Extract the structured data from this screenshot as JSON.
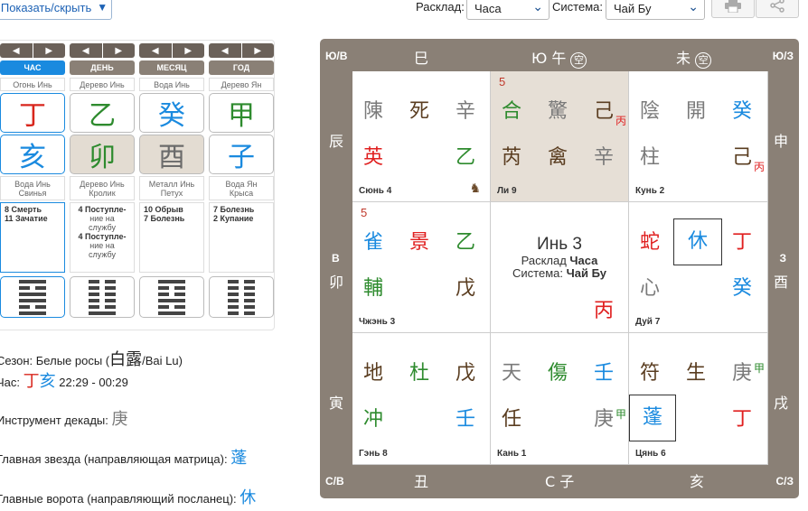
{
  "toolbar": {
    "toggle_label": "Показать/скрыть",
    "layout_label": "Расклад:",
    "layout_value": "Часа",
    "system_label": "Система:",
    "system_value": "Чай Бу"
  },
  "calendar": {
    "columns": [
      {
        "head": "ЧАС",
        "element": "Огонь Инь",
        "stem": "丁",
        "branch": "亥",
        "animal1": "Вода Инь",
        "animal2": "Свинья",
        "spirits": [
          "8 Смерть",
          "11 Зачатие"
        ]
      },
      {
        "head": "ДЕНЬ",
        "element": "Дерево Инь",
        "stem": "乙",
        "branch": "卯",
        "animal1": "Дерево Инь",
        "animal2": "Кролик",
        "spirits": [
          "4 Поступле-",
          "ние на",
          "службу",
          "4 Поступле-",
          "ние на",
          "службу"
        ]
      },
      {
        "head": "МЕСЯЦ",
        "element": "Вода Инь",
        "stem": "癸",
        "branch": "酉",
        "animal1": "Металл Инь",
        "animal2": "Петух",
        "spirits": [
          "10 Обрыв",
          "7 Болезнь"
        ]
      },
      {
        "head": "ГОД",
        "element": "Дерево Ян",
        "stem": "甲",
        "branch": "子",
        "animal1": "Вода Ян",
        "animal2": "Крыса",
        "spirits": [
          "7 Болезнь",
          "2 Купание"
        ]
      }
    ]
  },
  "info": {
    "season_label": "Сезон: Белые росы (",
    "season_ch": "白露",
    "season_tail": "/Bai Lu)",
    "hour_label": "Час:",
    "hour_ch1": "丁",
    "hour_ch2": "亥",
    "hour_time": "22:29 - 00:29",
    "decade_label": "Инструмент декады:",
    "decade_ch": "庚",
    "star_label": "Главная звезда (направляющая матрица):",
    "star_ch": "蓬",
    "gate_label": "Главные ворота (направляющий посланец):",
    "gate_ch": "休"
  },
  "board": {
    "corners": {
      "tl": "Ю/В",
      "tr": "Ю/З",
      "bl": "С/В",
      "br": "С/З"
    },
    "top": [
      "巳",
      "Ю 午",
      "未"
    ],
    "bottom": [
      "丑",
      "С 子",
      "亥"
    ],
    "left": [
      "辰",
      "В",
      "卯",
      "寅"
    ],
    "right": [
      "申",
      "З",
      "酉",
      "戌"
    ],
    "void_mark": "空",
    "cells": {
      "xun": {
        "name": "Сюнь 4",
        "r1": [
          "陳",
          "死",
          "辛"
        ],
        "r2": [
          "英",
          "",
          "乙"
        ]
      },
      "li": {
        "name": "Ли 9",
        "num": "5",
        "r1": [
          "合",
          "驚",
          "己"
        ],
        "r1sub": "丙",
        "r2": [
          "芮",
          "禽",
          "辛"
        ]
      },
      "kun": {
        "name": "Кунь 2",
        "r1": [
          "陰",
          "開",
          "癸"
        ],
        "r2": [
          "柱",
          "",
          "己"
        ],
        "r2sub": "丙"
      },
      "zhen": {
        "name": "Чжэнь 3",
        "num": "5",
        "r1": [
          "雀",
          "景",
          "乙"
        ],
        "r2": [
          "輔",
          "",
          "戊"
        ]
      },
      "center": {
        "title": "Инь 3",
        "l1a": "Расклад ",
        "l1b": "Часа",
        "l2a": "Система: ",
        "l2b": "Чай Бу",
        "bottom": "丙"
      },
      "dui": {
        "name": "Дуй 7",
        "r1": [
          "蛇",
          "休",
          "丁"
        ],
        "r2": [
          "心",
          "",
          "癸"
        ]
      },
      "gen": {
        "name": "Гэнь 8",
        "r1": [
          "地",
          "杜",
          "戊"
        ],
        "r2": [
          "冲",
          "",
          "壬"
        ]
      },
      "kan": {
        "name": "Кань 1",
        "r1": [
          "天",
          "傷",
          "壬"
        ],
        "r2": [
          "任",
          "",
          "庚"
        ],
        "r2sub": "甲"
      },
      "qian": {
        "name": "Цянь 6",
        "r1": [
          "符",
          "生",
          "庚"
        ],
        "r1sub": "甲",
        "r2": [
          "蓬",
          "",
          "丁"
        ]
      }
    }
  }
}
